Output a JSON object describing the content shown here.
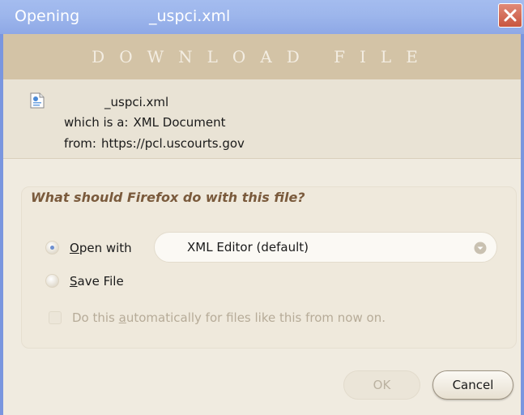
{
  "window": {
    "title_prefix": "Opening",
    "title_filename": "_uspci.xml",
    "close_icon": "close-icon"
  },
  "banner": {
    "text": "DOWNLOAD FILE"
  },
  "file": {
    "icon": "xml-document-icon",
    "name": "_uspci.xml",
    "type_label": "which is a:",
    "type_value": "XML Document",
    "from_label": "from:",
    "from_value": "https://pcl.uscourts.gov"
  },
  "action_group": {
    "legend": "What should Firefox do with this file?",
    "open_with": {
      "label_accesskey": "O",
      "label_rest": "pen with",
      "selected": true
    },
    "save_file": {
      "label_accesskey": "S",
      "label_rest": "ave File",
      "selected": false
    },
    "app_select": {
      "value": "XML Editor (default)"
    },
    "auto": {
      "label_pre": "Do this ",
      "label_accesskey": "a",
      "label_post": "utomatically for files like this from now on.",
      "checked": false,
      "enabled": false
    }
  },
  "buttons": {
    "ok": "OK",
    "cancel": "Cancel"
  },
  "colors": {
    "titlebar": "#9db6ec",
    "banner": "#d3c3a6",
    "legend": "#7a5a3c",
    "radio_dot": "#6d8fd0"
  }
}
